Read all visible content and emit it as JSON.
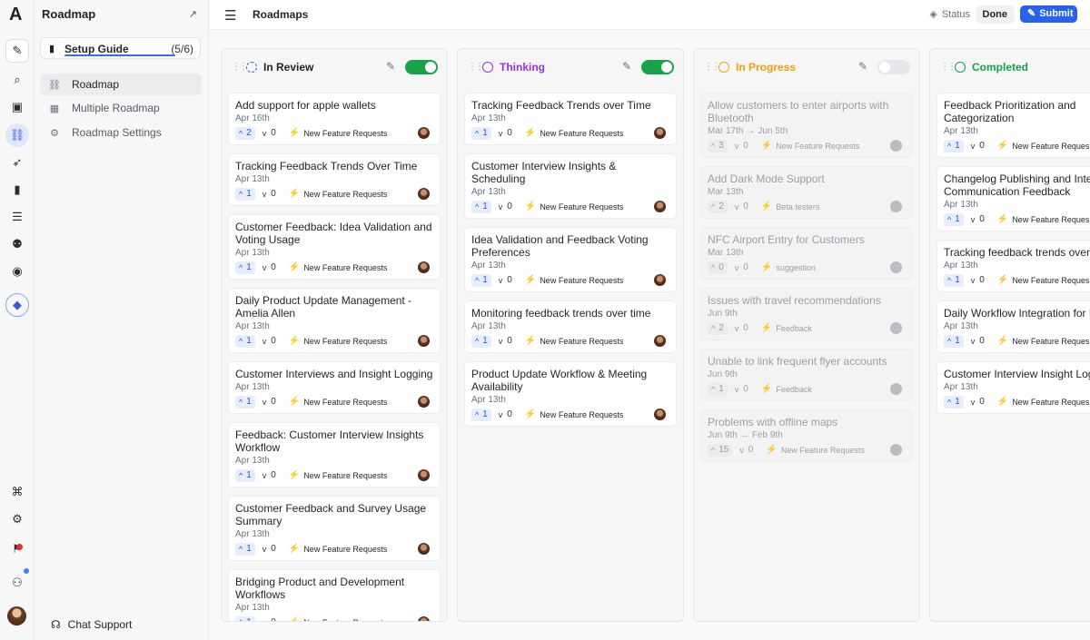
{
  "colors": {
    "accent": "#2563eb",
    "toggle_on": "#16a34a",
    "in_review": "#2563eb",
    "thinking": "#9333ea",
    "in_progress": "#f59e0b",
    "completed": "#16a34a"
  },
  "rail": {
    "logo": "A",
    "icons": [
      "edit-icon",
      "search-icon",
      "box-icon",
      "roadmap-icon",
      "rocket-icon",
      "book-icon",
      "notes-icon",
      "users-icon",
      "ai-icon",
      "diamond-icon",
      "command-icon",
      "gear-icon",
      "alert-icon",
      "user-icon"
    ]
  },
  "sidebar": {
    "title": "Roadmap",
    "setup_guide": {
      "label": "Setup Guide",
      "count": "(5/6)",
      "progress": 0.83
    },
    "items": [
      {
        "label": "Roadmap",
        "icon": "roadmap-icon",
        "active": true
      },
      {
        "label": "Multiple Roadmap",
        "icon": "grid-icon",
        "active": false
      },
      {
        "label": "Roadmap Settings",
        "icon": "settings-icon",
        "active": false
      }
    ],
    "chat_support": "Chat Support"
  },
  "topbar": {
    "breadcrumb": "Roadmaps",
    "status_label": "Status",
    "done_label": "Done",
    "submit_label": "Submit"
  },
  "columns": [
    {
      "label": "In Review",
      "toggle": true,
      "muted": false,
      "cards": [
        {
          "title": "Add support for apple wallets",
          "date": "Apr 16th",
          "up": "2",
          "down": "0",
          "tag": "New Feature Requests"
        },
        {
          "title": "Tracking Feedback Trends Over Time",
          "date": "Apr 13th",
          "up": "1",
          "down": "0",
          "tag": "New Feature Requests"
        },
        {
          "title": "Customer Feedback: Idea Validation and Voting Usage",
          "date": "Apr 13th",
          "up": "1",
          "down": "0",
          "tag": "New Feature Requests"
        },
        {
          "title": "Daily Product Update Management - Amelia Allen",
          "date": "Apr 13th",
          "up": "1",
          "down": "0",
          "tag": "New Feature Requests"
        },
        {
          "title": "Customer Interviews and Insight Logging",
          "date": "Apr 13th",
          "up": "1",
          "down": "0",
          "tag": "New Feature Requests"
        },
        {
          "title": "Feedback: Customer Interview Insights Workflow",
          "date": "Apr 13th",
          "up": "1",
          "down": "0",
          "tag": "New Feature Requests"
        },
        {
          "title": "Customer Feedback and Survey Usage Summary",
          "date": "Apr 13th",
          "up": "1",
          "down": "0",
          "tag": "New Feature Requests"
        },
        {
          "title": "Bridging Product and Development Workflows",
          "date": "Apr 13th",
          "up": "1",
          "down": "0",
          "tag": "New Feature Requests"
        }
      ]
    },
    {
      "label": "Thinking",
      "toggle": true,
      "muted": false,
      "cards": [
        {
          "title": "Tracking Feedback Trends over Time",
          "date": "Apr 13th",
          "up": "1",
          "down": "0",
          "tag": "New Feature Requests"
        },
        {
          "title": "Customer Interview Insights & Scheduling",
          "date": "Apr 13th",
          "up": "1",
          "down": "0",
          "tag": "New Feature Requests"
        },
        {
          "title": "Idea Validation and Feedback Voting Preferences",
          "date": "Apr 13th",
          "up": "1",
          "down": "0",
          "tag": "New Feature Requests"
        },
        {
          "title": "Monitoring feedback trends over time",
          "date": "Apr 13th",
          "up": "1",
          "down": "0",
          "tag": "New Feature Requests"
        },
        {
          "title": "Product Update Workflow & Meeting Availability",
          "date": "Apr 13th",
          "up": "1",
          "down": "0",
          "tag": "New Feature Requests"
        }
      ]
    },
    {
      "label": "In Progress",
      "toggle": false,
      "muted": true,
      "cards": [
        {
          "title": "Allow customers to enter airports with Bluetooth",
          "date": "Mar 17th",
          "date_end": "Jun 5th",
          "up": "3",
          "down": "0",
          "tag": "New Feature Requests"
        },
        {
          "title": "Add Dark Mode Support",
          "date": "Mar 13th",
          "up": "2",
          "down": "0",
          "tag": "Beta testers"
        },
        {
          "title": "NFC Airport Entry for Customers",
          "date": "Mar 13th",
          "up": "0",
          "down": "0",
          "tag": "suggestion"
        },
        {
          "title": "Issues with travel recommendations",
          "date": "Jun 9th",
          "up": "2",
          "down": "0",
          "tag": "Feedback"
        },
        {
          "title": "Unable to link frequent flyer accounts",
          "date": "Jun 9th",
          "up": "1",
          "down": "0",
          "tag": "Feedback"
        },
        {
          "title": "Problems with offline maps",
          "date": "Jun 9th",
          "date_end": "Feb 9th",
          "up": "15",
          "down": "0",
          "tag": "New Feature Requests"
        }
      ]
    },
    {
      "label": "Completed",
      "toggle": false,
      "muted": false,
      "cards": [
        {
          "title": "Feedback Prioritization and Categorization",
          "date": "Apr 13th",
          "up": "1",
          "down": "0",
          "tag": "New Feature Reques"
        },
        {
          "title": "Changelog Publishing and Inter Communication Feedback",
          "date": "Apr 13th",
          "up": "1",
          "down": "0",
          "tag": "New Feature Reques"
        },
        {
          "title": "Tracking feedback trends over t",
          "date": "Apr 13th",
          "up": "1",
          "down": "0",
          "tag": "New Feature Reques"
        },
        {
          "title": "Daily Workflow Integration for P Updates",
          "date": "Apr 13th",
          "up": "1",
          "down": "0",
          "tag": "New Feature Reques"
        },
        {
          "title": "Customer Interview Insight Logg",
          "date": "Apr 13th",
          "up": "1",
          "down": "0",
          "tag": "New Feature Reques"
        }
      ]
    }
  ]
}
